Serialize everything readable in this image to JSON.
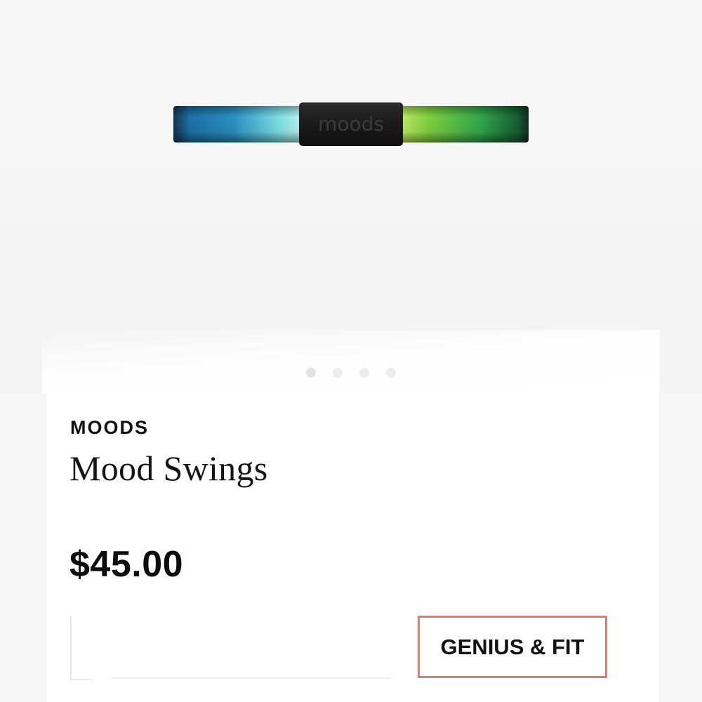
{
  "product": {
    "image_label": "moods",
    "image_icon": "product-tube-image",
    "brand": "MOODS",
    "name": "Mood Swings",
    "price": "$45.00"
  },
  "actions": {
    "genius_fit_label": "GENIUS & FIT"
  },
  "carousel": {
    "dot_count": 4,
    "active_index": 0
  },
  "colors": {
    "button_border": "#e07a76",
    "tube_left": "#1f6fa8",
    "tube_right": "#2fa84a",
    "cap": "#1a1a1a"
  }
}
